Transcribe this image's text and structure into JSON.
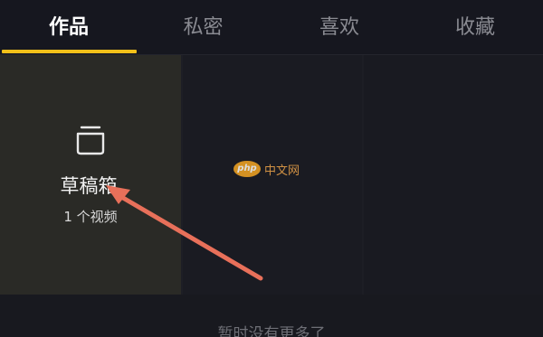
{
  "tabs": [
    {
      "label": "作品",
      "active": true
    },
    {
      "label": "私密",
      "active": false
    },
    {
      "label": "喜欢",
      "active": false
    },
    {
      "label": "收藏",
      "active": false
    }
  ],
  "draft": {
    "title": "草稿箱",
    "count": "1 个视频",
    "icon": "draft-box-icon"
  },
  "footer": {
    "no_more": "暂时没有更多了"
  },
  "watermark": {
    "logo_text": "php",
    "text": "中文网"
  },
  "colors": {
    "background": "#16171f",
    "tab_indicator": "#f3c019",
    "draft_card": "#2a2a26",
    "annotation_arrow": "#e8705a"
  }
}
